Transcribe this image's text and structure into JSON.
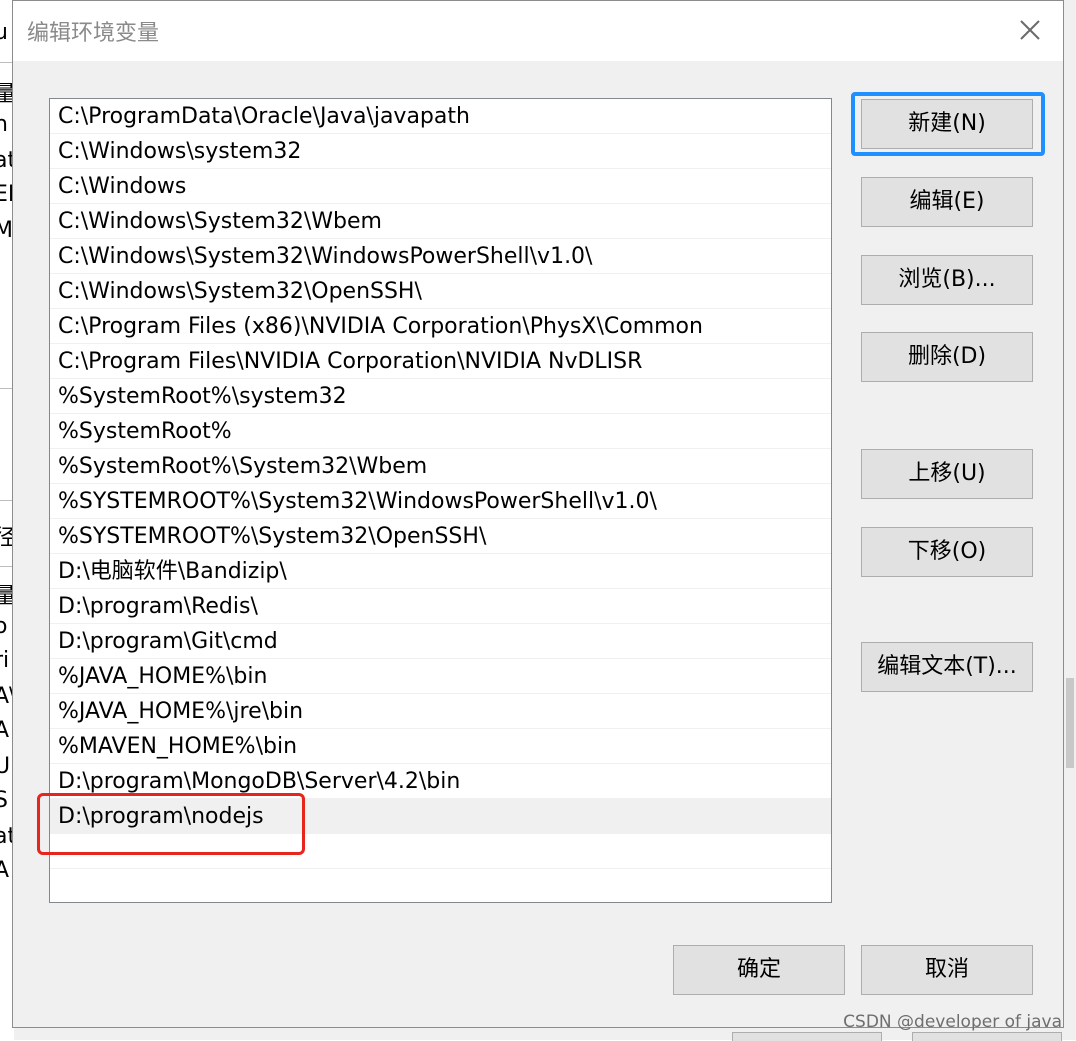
{
  "dialog": {
    "title": "编辑环境变量",
    "close_icon": "close-icon"
  },
  "path_list": {
    "items": [
      "C:\\ProgramData\\Oracle\\Java\\javapath",
      "C:\\Windows\\system32",
      "C:\\Windows",
      "C:\\Windows\\System32\\Wbem",
      "C:\\Windows\\System32\\WindowsPowerShell\\v1.0\\",
      "C:\\Windows\\System32\\OpenSSH\\",
      "C:\\Program Files (x86)\\NVIDIA Corporation\\PhysX\\Common",
      "C:\\Program Files\\NVIDIA Corporation\\NVIDIA NvDLISR",
      "%SystemRoot%\\system32",
      "%SystemRoot%",
      "%SystemRoot%\\System32\\Wbem",
      "%SYSTEMROOT%\\System32\\WindowsPowerShell\\v1.0\\",
      "%SYSTEMROOT%\\System32\\OpenSSH\\",
      "D:\\电脑软件\\Bandizip\\",
      "D:\\program\\Redis\\",
      "D:\\program\\Git\\cmd",
      "%JAVA_HOME%\\bin",
      "%JAVA_HOME%\\jre\\bin",
      "%MAVEN_HOME%\\bin",
      "D:\\program\\MongoDB\\Server\\4.2\\bin",
      "D:\\program\\nodejs"
    ],
    "selected_index": 20
  },
  "buttons": {
    "new": "新建(N)",
    "edit": "编辑(E)",
    "browse": "浏览(B)...",
    "delete": "删除(D)",
    "move_up": "上移(U)",
    "move_down": "下移(O)",
    "edit_text": "编辑文本(T)...",
    "ok": "确定",
    "cancel": "取消"
  },
  "background_fragments": [
    "u",
    "量",
    "n",
    "at",
    "EI",
    "M",
    "径",
    "量",
    "o",
    "ri",
    "A\\",
    "A",
    "U",
    "S",
    "at",
    "A"
  ],
  "watermark": "CSDN @developer of java",
  "colors": {
    "focus_border": "#1e90ff",
    "annotation_border": "#e8251c",
    "dialog_bg": "#f0f0f0"
  }
}
